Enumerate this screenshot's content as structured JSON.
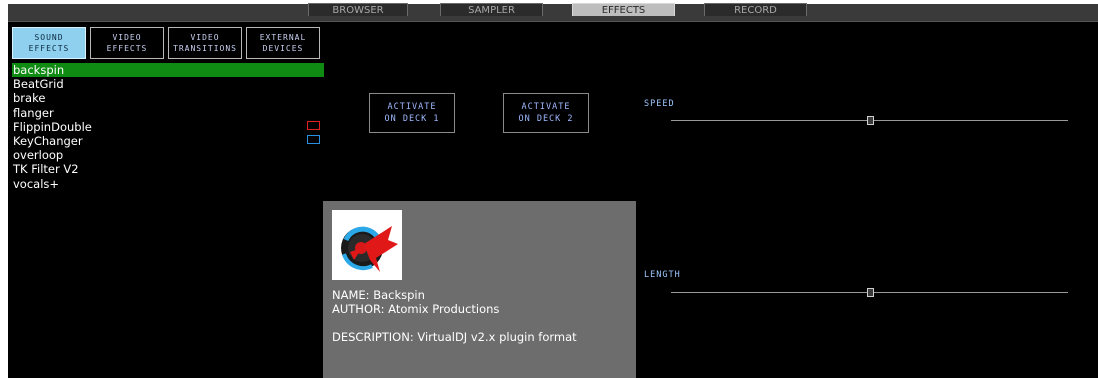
{
  "tabs": [
    {
      "label": "BROWSER",
      "active": false
    },
    {
      "label": "SAMPLER",
      "active": false
    },
    {
      "label": "EFFECTS",
      "active": true
    },
    {
      "label": "RECORD",
      "active": false
    }
  ],
  "categories": [
    {
      "label": "SOUND\nEFFECTS",
      "active": true
    },
    {
      "label": "VIDEO\nEFFECTS",
      "active": false
    },
    {
      "label": "VIDEO\nTRANSITIONS",
      "active": false
    },
    {
      "label": "EXTERNAL\nDEVICES",
      "active": false
    }
  ],
  "effects": [
    {
      "name": "backspin",
      "selected": true
    },
    {
      "name": "BeatGrid"
    },
    {
      "name": "brake"
    },
    {
      "name": "flanger"
    },
    {
      "name": "FlippinDouble"
    },
    {
      "name": "KeyChanger"
    },
    {
      "name": "overloop"
    },
    {
      "name": "TK Filter V2"
    },
    {
      "name": "vocals+"
    }
  ],
  "deck_markers": {
    "deck1_color": "#e02020",
    "deck2_color": "#2a8fe0"
  },
  "activate": {
    "deck1": "ACTIVATE\nON DECK 1",
    "deck2": "ACTIVATE\nON DECK 2"
  },
  "sliders": {
    "speed": {
      "label": "SPEED",
      "value": 0.5
    },
    "length": {
      "label": "LENGTH",
      "value": 0.5
    }
  },
  "info": {
    "logo_icon": "backspin-logo-icon",
    "name": "NAME: Backspin",
    "author": "AUTHOR: Atomix Productions",
    "description": "DESCRIPTION: VirtualDJ v2.x plugin format"
  }
}
